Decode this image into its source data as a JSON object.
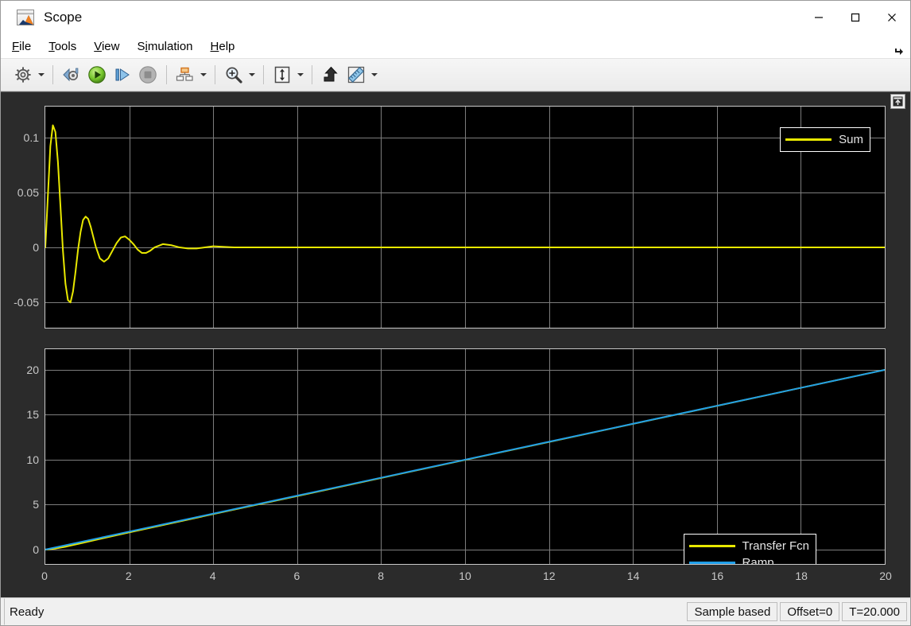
{
  "window": {
    "title": "Scope",
    "app_icon": "matlab-scope-icon",
    "controls": {
      "minimize": "minimize-button",
      "maximize": "maximize-button",
      "close": "close-button"
    }
  },
  "menu": {
    "items": [
      {
        "label": "File",
        "mnemonic": "F"
      },
      {
        "label": "Tools",
        "mnemonic": "T"
      },
      {
        "label": "View",
        "mnemonic": "V"
      },
      {
        "label": "Simulation",
        "mnemonic": "i"
      },
      {
        "label": "Help",
        "mnemonic": "H"
      }
    ],
    "expand_icon": "menu-expand-arrow-icon"
  },
  "toolbar": {
    "buttons": [
      {
        "name": "configuration-properties-icon",
        "tooltip": "Configuration Properties",
        "has_dropdown": true
      },
      {
        "name": "simulink-model-icon",
        "tooltip": "View Simulink Model",
        "has_dropdown": false
      },
      {
        "name": "run-icon",
        "tooltip": "Run",
        "has_dropdown": false
      },
      {
        "name": "step-forward-icon",
        "tooltip": "Step Forward",
        "has_dropdown": false
      },
      {
        "name": "stop-icon",
        "tooltip": "Stop",
        "has_dropdown": false
      },
      {
        "name": "layout-icon",
        "tooltip": "Layout",
        "has_dropdown": true
      },
      {
        "name": "zoom-in-icon",
        "tooltip": "Zoom In",
        "has_dropdown": true
      },
      {
        "name": "autoscale-icon",
        "tooltip": "Scale Axes Limits",
        "has_dropdown": true
      },
      {
        "name": "highlight-signal-icon",
        "tooltip": "Highlight Signal in Model",
        "has_dropdown": false
      },
      {
        "name": "measurements-icon",
        "tooltip": "Measurements",
        "has_dropdown": true
      }
    ]
  },
  "scope": {
    "popout_button": "popout-restore-button"
  },
  "status": {
    "message": "Ready",
    "cells": [
      "Sample based",
      "Offset=0",
      "T=20.000"
    ]
  },
  "colors": {
    "trace_yellow": "#e8e800",
    "trace_blue": "#1f9ee8",
    "plot_background": "#000000",
    "scope_background": "#2b2b2b",
    "grid": "#7d7d7d",
    "tick_text": "#c8c8c8"
  },
  "chart_data": [
    {
      "type": "line",
      "id": "top-plot",
      "title": "",
      "xlabel": "",
      "ylabel": "",
      "xlim": [
        0,
        20
      ],
      "ylim": [
        -0.073,
        0.128
      ],
      "xticks": [
        0,
        2,
        4,
        6,
        8,
        10,
        12,
        14,
        16,
        18,
        20
      ],
      "yticks": [
        -0.05,
        0,
        0.05,
        0.1
      ],
      "ytick_labels": [
        "-0.05",
        "0",
        "0.05",
        "0.1"
      ],
      "grid": true,
      "legend_position": "top-right",
      "series": [
        {
          "name": "Sum",
          "color": "#e8e800",
          "description": "Damped oscillation decaying to zero",
          "x": [
            0,
            0.06,
            0.12,
            0.18,
            0.24,
            0.3,
            0.36,
            0.42,
            0.48,
            0.54,
            0.6,
            0.66,
            0.72,
            0.78,
            0.84,
            0.9,
            0.96,
            1.02,
            1.08,
            1.14,
            1.2,
            1.3,
            1.4,
            1.5,
            1.6,
            1.7,
            1.8,
            1.9,
            2.0,
            2.1,
            2.2,
            2.3,
            2.4,
            2.5,
            2.6,
            2.8,
            3.0,
            3.2,
            3.4,
            3.6,
            3.8,
            4.0,
            4.5,
            5.0,
            6.0,
            8.0,
            10.0,
            14.0,
            20.0
          ],
          "y": [
            0.0,
            0.046,
            0.092,
            0.111,
            0.105,
            0.078,
            0.038,
            -0.003,
            -0.033,
            -0.048,
            -0.05,
            -0.04,
            -0.022,
            -0.002,
            0.014,
            0.025,
            0.028,
            0.026,
            0.019,
            0.01,
            0.001,
            -0.01,
            -0.013,
            -0.01,
            -0.003,
            0.004,
            0.009,
            0.01,
            0.007,
            0.003,
            -0.002,
            -0.005,
            -0.005,
            -0.003,
            0.0,
            0.003,
            0.002,
            0.0,
            -0.001,
            -0.001,
            0.0,
            0.001,
            0.0,
            0.0,
            0.0,
            0.0,
            0.0,
            0.0,
            0.0
          ]
        }
      ]
    },
    {
      "type": "line",
      "id": "bottom-plot",
      "title": "",
      "xlabel": "",
      "ylabel": "",
      "xlim": [
        0,
        20
      ],
      "ylim": [
        -1.6,
        22.3
      ],
      "xticks": [
        0,
        2,
        4,
        6,
        8,
        10,
        12,
        14,
        16,
        18,
        20
      ],
      "yticks": [
        0,
        5,
        10,
        15,
        20
      ],
      "ytick_labels": [
        "0",
        "5",
        "10",
        "15",
        "20"
      ],
      "grid": true,
      "legend_position": "center-right",
      "series": [
        {
          "name": "Transfer Fcn",
          "color": "#e8e800",
          "description": "Filtered ramp, lags slightly at the start then tracks the ramp",
          "x": [
            0,
            0.25,
            0.5,
            0.75,
            1,
            1.5,
            2,
            4,
            6,
            8,
            10,
            12,
            14,
            16,
            18,
            20
          ],
          "y": [
            0,
            0.12,
            0.34,
            0.6,
            0.87,
            1.4,
            1.92,
            3.95,
            5.96,
            7.97,
            9.98,
            11.98,
            13.99,
            15.99,
            18.0,
            20.0
          ]
        },
        {
          "name": "Ramp",
          "color": "#1f9ee8",
          "description": "Linear ramp with unit slope",
          "x": [
            0,
            2,
            4,
            6,
            8,
            10,
            12,
            14,
            16,
            18,
            20
          ],
          "y": [
            0,
            2,
            4,
            6,
            8,
            10,
            12,
            14,
            16,
            18,
            20
          ]
        }
      ]
    }
  ]
}
